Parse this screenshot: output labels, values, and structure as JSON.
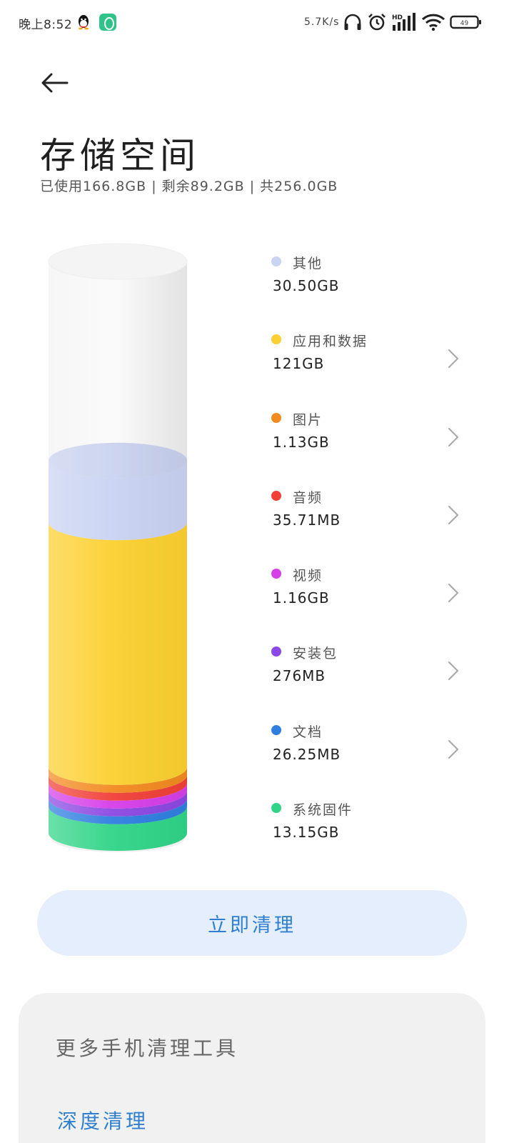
{
  "status_bar": {
    "time": "晚上8:52",
    "net_speed": "5.7K/s",
    "icons": [
      "qq-icon",
      "app-icon",
      "headphones-icon",
      "alarm-icon",
      "hd-signal-icon",
      "wifi-icon",
      "battery-icon"
    ],
    "battery_level": "49"
  },
  "header": {
    "back_icon": "back-arrow-icon",
    "title": "存储空间",
    "summary": "已使用166.8GB | 剩余89.2GB | 共256.0GB"
  },
  "storage": {
    "used_gb": 166.8,
    "free_gb": 89.2,
    "total_gb": 256.0,
    "categories": [
      {
        "label": "其他",
        "size": "30.50GB",
        "color": "#c9d3f2",
        "clickable": false
      },
      {
        "label": "应用和数据",
        "size": "121GB",
        "color": "#fcd030",
        "clickable": true
      },
      {
        "label": "图片",
        "size": "1.13GB",
        "color": "#f28a20",
        "clickable": true
      },
      {
        "label": "音频",
        "size": "35.71MB",
        "color": "#f04038",
        "clickable": true
      },
      {
        "label": "视频",
        "size": "1.16GB",
        "color": "#d63ee8",
        "clickable": true
      },
      {
        "label": "安装包",
        "size": "276MB",
        "color": "#8c48e2",
        "clickable": true
      },
      {
        "label": "文档",
        "size": "26.25MB",
        "color": "#2f7fe0",
        "clickable": true
      },
      {
        "label": "系统固件",
        "size": "13.15GB",
        "color": "#30d488",
        "clickable": false
      }
    ]
  },
  "actions": {
    "clean_label": "立即清理"
  },
  "tools": {
    "title": "更多手机清理工具",
    "first_item": "深度清理"
  },
  "colors": {
    "accent": "#2f7fd0",
    "button_bg": "#e4eefc",
    "card_bg": "#f1f1f1"
  }
}
